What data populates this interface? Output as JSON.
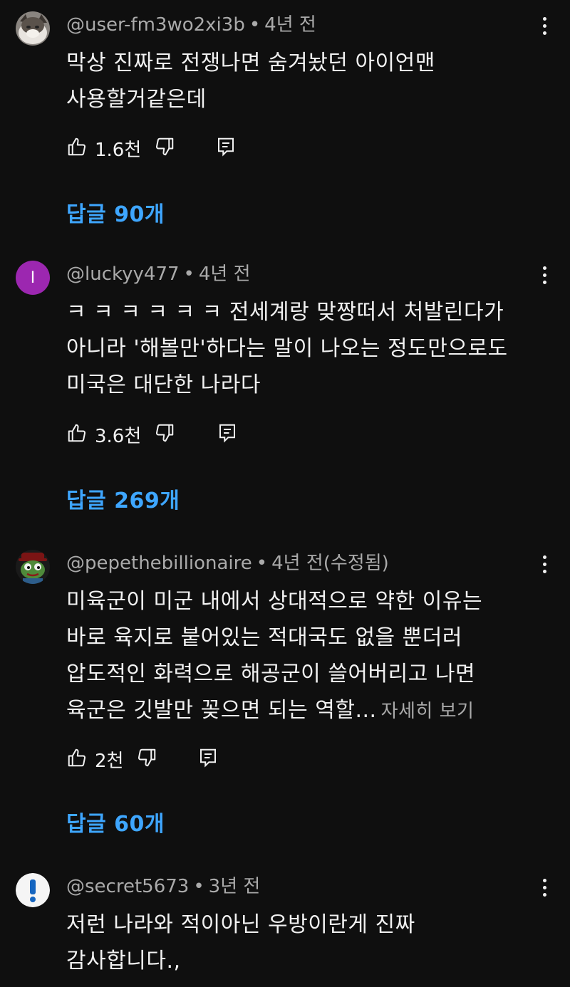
{
  "comments": [
    {
      "author": "@user-fm3wo2xi3b",
      "time": "4년 전",
      "text": "막상 진짜로 전쟁나면 숨겨놨던 아이언맨\n사용할거같은데",
      "more_label": "",
      "likes": "1.6천",
      "replies": "답글 90개",
      "avatar": "cat-photo"
    },
    {
      "author": "@luckyy477",
      "time": "4년 전",
      "text": "ㅋ ㅋ ㅋ ㅋ ㅋ ㅋ  전세계랑 맞짱떠서 처발린다가\n아니라 '해볼만'하다는 말이 나오는 정도만으로도\n미국은 대단한 나라다",
      "more_label": "",
      "likes": "3.6천",
      "replies": "답글 269개",
      "avatar_letter": "I",
      "avatar_color": "#9c27b0"
    },
    {
      "author": "@pepethebillionaire",
      "time": "4년 전(수정됨)",
      "text": "미육군이 미군 내에서 상대적으로 약한 이유는\n바로 육지로 붙어있는 적대국도 없을 뿐더러\n압도적인 화력으로 해공군이 쓸어버리고 나면\n육군은 깃발만 꽂으면 되는 역할...",
      "more_label": "자세히 보기",
      "likes": "2천",
      "replies": "답글 60개",
      "avatar": "pepe-frog"
    },
    {
      "author": "@secret5673",
      "time": "3년 전",
      "text": "저런 나라와 적이아닌 우방이란게 진짜\n감사합니다.,",
      "more_label": "",
      "avatar": "exclamation"
    }
  ],
  "colors": {
    "background": "#0f0f0f",
    "text": "#f1f1f1",
    "secondary": "#aaaaaa",
    "link": "#3ea6ff"
  },
  "icons": [
    "thumb-up-icon",
    "thumb-down-icon",
    "reply-icon",
    "more-vert-icon"
  ]
}
